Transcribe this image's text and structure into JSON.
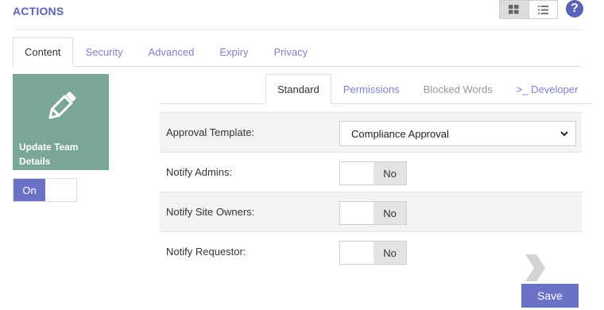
{
  "header": {
    "title": "ACTIONS",
    "view_grid_icon": "grid-view-icon",
    "view_list_icon": "list-view-icon",
    "help_icon": "help-icon",
    "help_glyph": "?"
  },
  "main_tabs": [
    {
      "label": "Content",
      "active": true
    },
    {
      "label": "Security"
    },
    {
      "label": "Advanced"
    },
    {
      "label": "Expiry"
    },
    {
      "label": "Privacy"
    }
  ],
  "action_tile": {
    "icon": "pencil-icon",
    "label": "Update Team Details",
    "toggle_label": "On",
    "color": "#7aa696"
  },
  "sub_tabs": [
    {
      "label": "Standard",
      "active": true
    },
    {
      "label": "Permissions"
    },
    {
      "label": "Blocked Words",
      "disabled": true
    },
    {
      "label": ">_ Developer"
    }
  ],
  "form": {
    "approval_template": {
      "label": "Approval Template:",
      "value": "Compliance Approval"
    },
    "notify_admins": {
      "label": "Notify Admins:",
      "value": "No"
    },
    "notify_site_owners": {
      "label": "Notify Site Owners:",
      "value": "No"
    },
    "notify_requestor": {
      "label": "Notify Requestor:",
      "value": "No"
    }
  },
  "footer": {
    "save_label": "Save"
  },
  "colors": {
    "accent": "#6b72c6",
    "tab_link": "#7c82c5",
    "header": "#5b62b8"
  }
}
